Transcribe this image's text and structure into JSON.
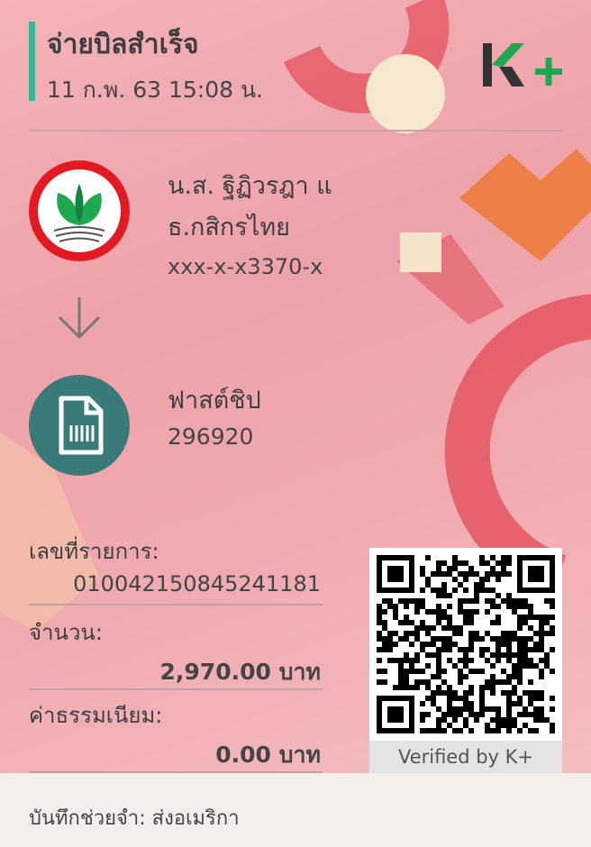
{
  "header": {
    "title": "จ่ายบิลสำเร็จ",
    "datetime": "11 ก.พ. 63  15:08 น.",
    "logo": "K+"
  },
  "from": {
    "name": "น.ส. ฐิฏิวรฎา แ",
    "bank": "ธ.กสิกรไทย",
    "account": "xxx-x-x3370-x",
    "icon": "kbank-logo-icon"
  },
  "to": {
    "name": "ฟาสต์ชิป",
    "code": "296920",
    "icon": "bill-document-icon"
  },
  "details": {
    "ref_label": "เลขที่รายการ:",
    "ref_value": "010042150845241181",
    "amount_label": "จำนวน:",
    "amount_value": "2,970.00 บาท",
    "fee_label": "ค่าธรรมเนียม:",
    "fee_value": "0.00 บาท"
  },
  "qr": {
    "verified_label": "Verified by K+"
  },
  "memo": {
    "text": "บันทึกช่วยจำ: ส่งอเมริกา"
  },
  "colors": {
    "accent_green": "#39b59a",
    "kbank_red": "#e21b23",
    "kbank_green": "#1fa84f",
    "biller_teal": "#3a7a78"
  }
}
